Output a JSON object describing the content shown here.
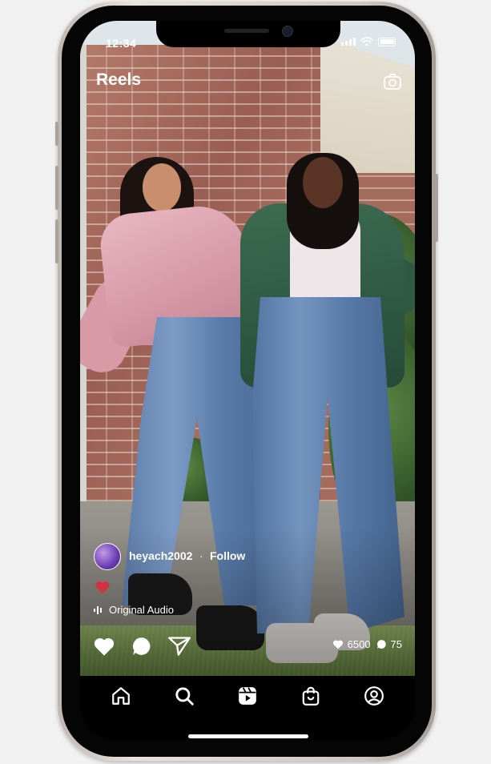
{
  "status_bar": {
    "time": "12:34"
  },
  "header": {
    "title": "Reels",
    "camera_icon": "camera-icon"
  },
  "post": {
    "username": "heyach2002",
    "separator": "·",
    "follow_label": "Follow",
    "audio": "Original Audio",
    "likes": "6500",
    "comments": "75"
  },
  "nav": {
    "items": [
      "home-icon",
      "search-icon",
      "reels-icon",
      "shop-icon",
      "profile-icon"
    ]
  },
  "colors": {
    "overlay_text": "#ffffff",
    "nav_background": "#000000",
    "like_red": "#e0313f"
  }
}
